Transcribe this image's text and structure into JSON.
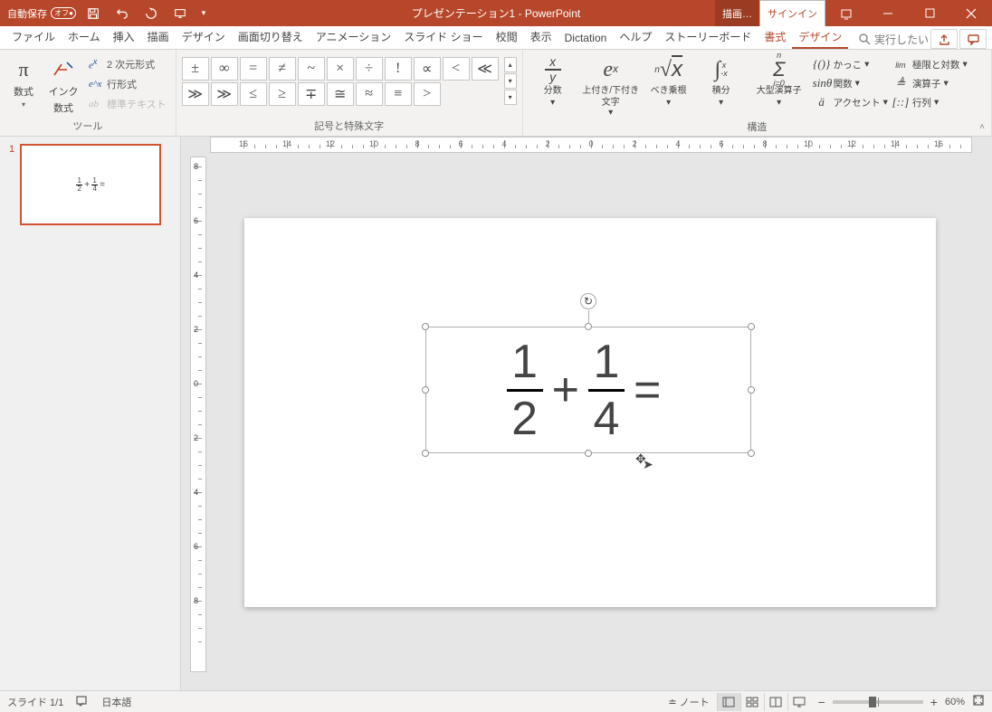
{
  "titlebar": {
    "autosave_label": "自動保存",
    "autosave_state": "オフ",
    "title": "プレゼンテーション1 - PowerPoint",
    "draw_label": "描画…",
    "signin_label": "サインイン"
  },
  "tabs": {
    "file": "ファイル",
    "home": "ホーム",
    "insert": "挿入",
    "draw": "描画",
    "design": "デザイン",
    "transitions": "画面切り替え",
    "animations": "アニメーション",
    "slideshow": "スライド ショー",
    "review": "校閲",
    "view": "表示",
    "dictation": "Dictation",
    "help": "ヘルプ",
    "storyboarding": "ストーリーボード",
    "format": "書式",
    "eqdesign": "デザイン",
    "search": "実行したい"
  },
  "ribbon": {
    "tools_group": "ツール",
    "equation_btn": "数式",
    "ink_btn_l1": "インク",
    "ink_btn_l2": "数式",
    "prof_2d": "2 次元形式",
    "prof_lin": "行形式",
    "prof_plain": "標準テキスト",
    "symbols_group": "記号と特殊文字",
    "symbols_row1": [
      "±",
      "∞",
      "=",
      "≠",
      "~",
      "×",
      "÷",
      "!",
      "∝",
      "<"
    ],
    "symbols_row2": [
      "≪",
      "≫",
      "≫",
      "≤",
      "≥",
      "∓",
      "≅",
      "≈",
      "≡",
      ">"
    ],
    "structures_group": "構造",
    "fraction": "分数",
    "subsup_l1": "上付き/下付き",
    "subsup_l2": "文字",
    "radical": "べき乗根",
    "integral": "積分",
    "largeop": "大型演算子",
    "bracket": "かっこ",
    "function": "関数",
    "accent": "アクセント",
    "limlog": "極限と対数",
    "operator": "演算子",
    "matrix": "行列"
  },
  "thumb": {
    "number": "1"
  },
  "equation": {
    "n1": "1",
    "d1": "2",
    "op": "+",
    "n2": "1",
    "d2": "4",
    "eq": "="
  },
  "statusbar": {
    "slide": "スライド 1/1",
    "lang": "日本語",
    "notes": "ノート",
    "zoom_minus": "−",
    "zoom_plus": "+",
    "zoom_pct": "60%"
  },
  "ruler_labels": [
    "16",
    "14",
    "12",
    "10",
    "8",
    "6",
    "4",
    "2",
    "0",
    "2",
    "4",
    "6",
    "8",
    "10",
    "12",
    "14",
    "16"
  ],
  "vruler_labels": [
    "8",
    "6",
    "4",
    "2",
    "0",
    "2",
    "4",
    "6",
    "8"
  ]
}
